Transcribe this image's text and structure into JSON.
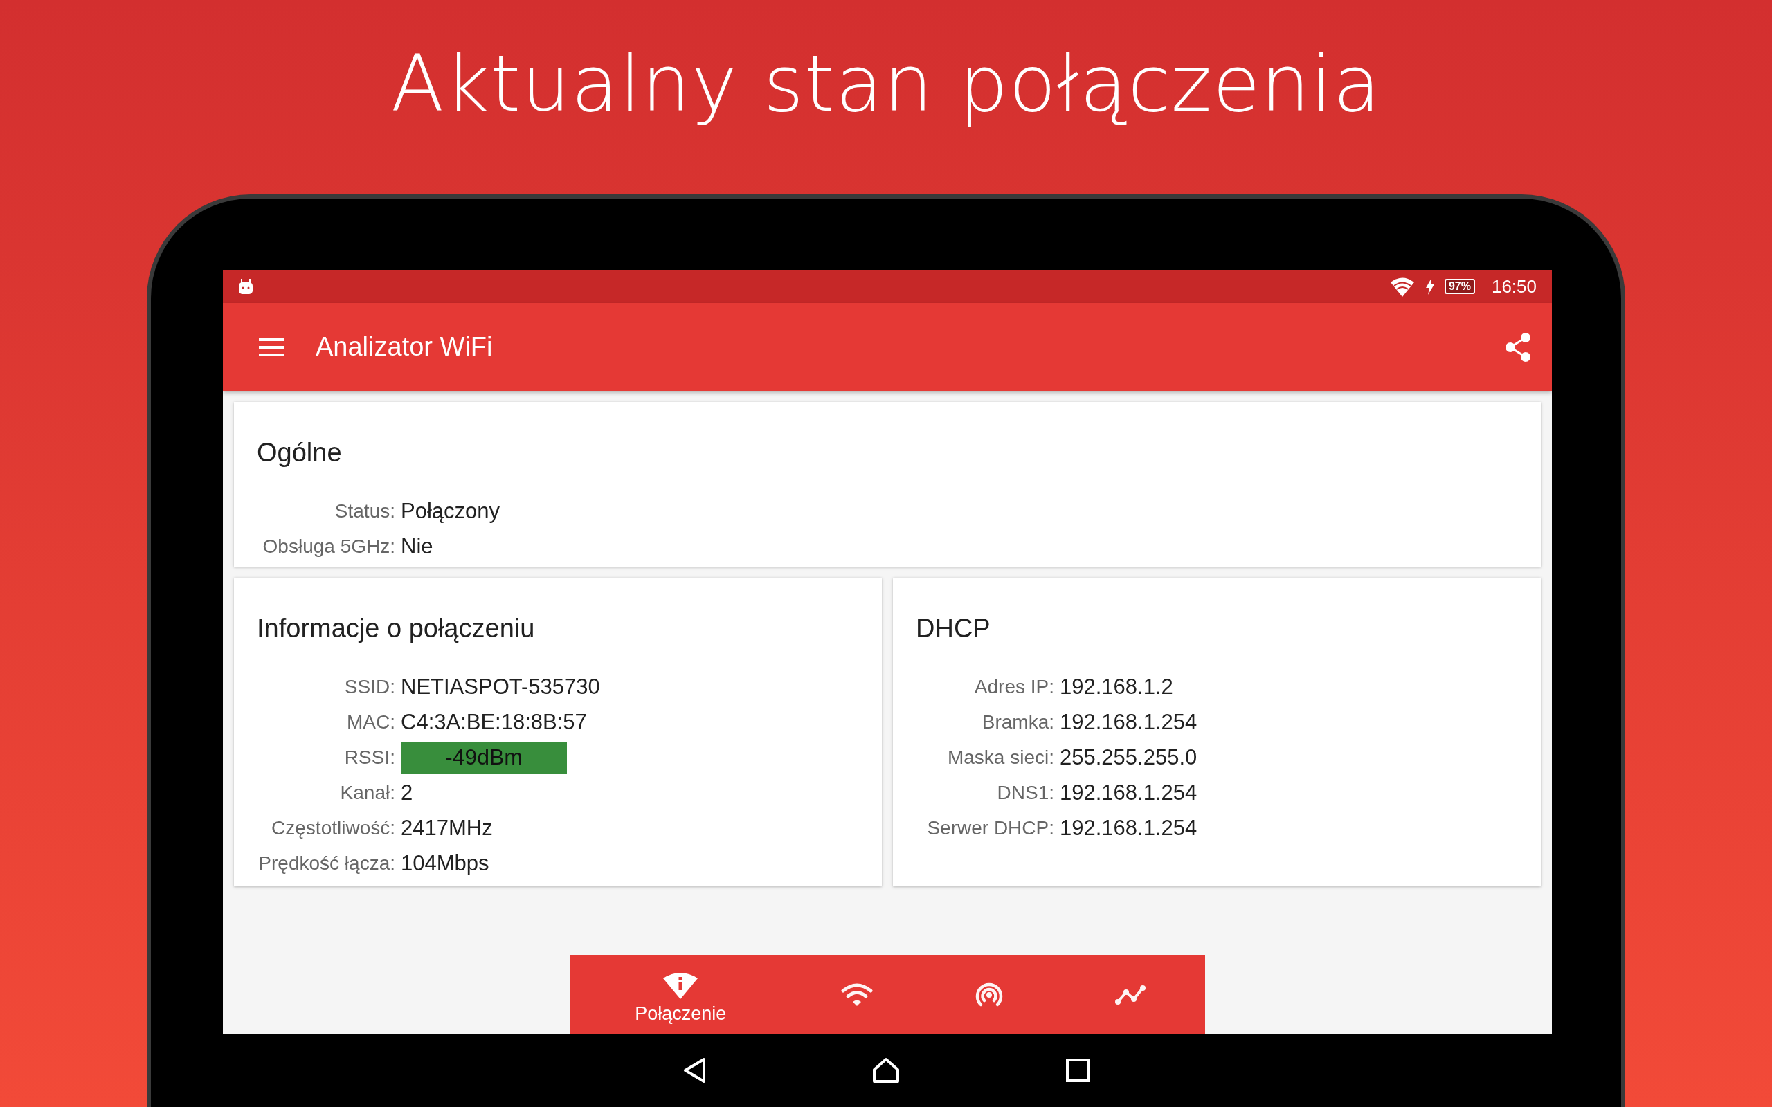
{
  "headline": "Aktualny stan połączenia",
  "status_bar": {
    "battery": "97%",
    "time": "16:50"
  },
  "app_bar": {
    "title": "Analizator WiFi"
  },
  "cards": [
    {
      "title": "Ogólne",
      "rows": [
        {
          "kind": "text",
          "label": "Status:",
          "value": "Połączony"
        },
        {
          "kind": "text",
          "label": "Obsługa 5GHz:",
          "value": "Nie"
        }
      ]
    },
    {
      "title": "Informacje o połączeniu",
      "rows": [
        {
          "kind": "text",
          "label": "SSID:",
          "value": "NETIASPOT-535730"
        },
        {
          "kind": "text",
          "label": "MAC:",
          "value": "C4:3A:BE:18:8B:57"
        },
        {
          "kind": "badge",
          "label": "RSSI:",
          "value": "-49dBm",
          "color": "#388e3c"
        },
        {
          "kind": "text",
          "label": "Kanał:",
          "value": "2"
        },
        {
          "kind": "text",
          "label": "Częstotliwość:",
          "value": "2417MHz"
        },
        {
          "kind": "text",
          "label": "Prędkość łącza:",
          "value": "104Mbps"
        }
      ]
    },
    {
      "title": "DHCP",
      "rows": [
        {
          "kind": "text",
          "label": "Adres IP:",
          "value": "192.168.1.2"
        },
        {
          "kind": "text",
          "label": "Bramka:",
          "value": "192.168.1.254"
        },
        {
          "kind": "text",
          "label": "Maska sieci:",
          "value": "255.255.255.0"
        },
        {
          "kind": "text",
          "label": "DNS1:",
          "value": "192.168.1.254"
        },
        {
          "kind": "text",
          "label": "Serwer DHCP:",
          "value": "192.168.1.254"
        }
      ]
    }
  ],
  "bottom_nav": [
    {
      "kind": "info",
      "label": "Połączenie",
      "selected": true
    },
    {
      "kind": "wifi",
      "selected": false
    },
    {
      "kind": "signal",
      "selected": false
    },
    {
      "kind": "graph",
      "selected": false
    }
  ]
}
